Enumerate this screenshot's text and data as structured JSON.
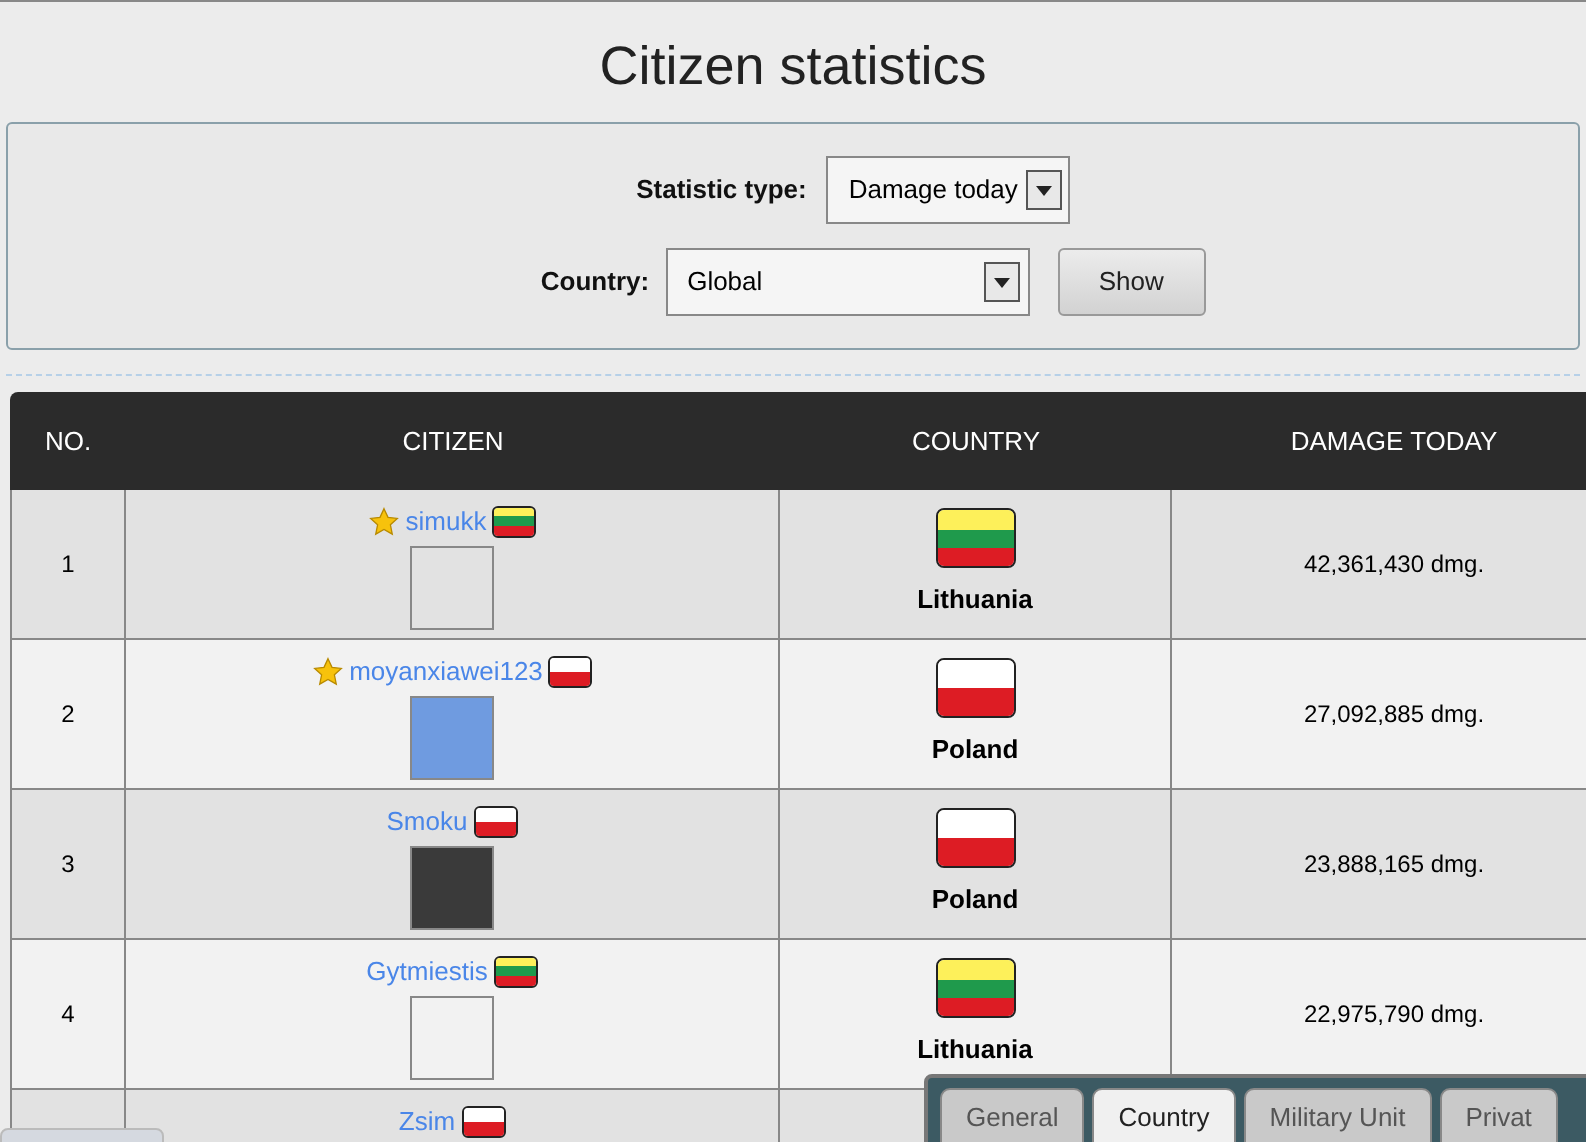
{
  "title": "Citizen statistics",
  "filters": {
    "statistic_type": {
      "label": "Statistic type:",
      "value": "Damage today"
    },
    "country": {
      "label": "Country:",
      "value": "Global"
    },
    "show_button": "Show"
  },
  "table": {
    "columns": [
      "NO.",
      "CITIZEN",
      "COUNTRY",
      "DAMAGE TODAY"
    ],
    "rows": [
      {
        "no": "1",
        "citizen": "simukk",
        "premium": true,
        "flag": {
          "kind": "lithuania"
        },
        "avatar": {
          "kind": "empty"
        },
        "country": "Lithuania",
        "damage": "42,361,430 dmg."
      },
      {
        "no": "2",
        "citizen": "moyanxiawei123",
        "premium": true,
        "flag": {
          "kind": "poland"
        },
        "avatar": {
          "kind": "picture"
        },
        "country": "Poland",
        "damage": "27,092,885 dmg."
      },
      {
        "no": "3",
        "citizen": "Smoku",
        "premium": false,
        "flag": {
          "kind": "poland"
        },
        "avatar": {
          "kind": "picture"
        },
        "country": "Poland",
        "damage": "23,888,165 dmg."
      },
      {
        "no": "4",
        "citizen": "Gytmiestis",
        "premium": false,
        "flag": {
          "kind": "lithuania"
        },
        "avatar": {
          "kind": "empty"
        },
        "country": "Lithuania",
        "damage": "22,975,790 dmg."
      },
      {
        "citizen": "Zsim",
        "premium": false,
        "flag": {
          "kind": "poland"
        }
      }
    ]
  },
  "overlay_tabs": [
    {
      "label": "General",
      "selected": false
    },
    {
      "label": "Country",
      "selected": true
    },
    {
      "label": "Military Unit",
      "selected": false
    },
    {
      "label": "Privat",
      "selected": false
    }
  ]
}
